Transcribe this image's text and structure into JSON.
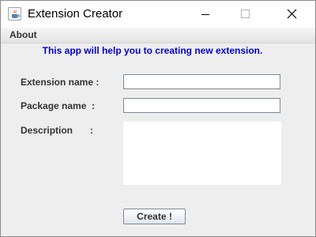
{
  "window": {
    "title": "Extension Creator",
    "icon": "java-cup-icon"
  },
  "title_buttons": {
    "minimize_icon": "minimize-icon",
    "maximize_icon": "maximize-icon",
    "close_icon": "close-icon"
  },
  "menubar": {
    "items": [
      {
        "label": "About"
      }
    ]
  },
  "form": {
    "subtitle": "This app will help you to creating new extension.",
    "extension_name": {
      "label": "Extension name :",
      "value": ""
    },
    "package_name": {
      "label": "Package name  :",
      "value": ""
    },
    "description": {
      "label": "Description",
      "colon": ":",
      "value": ""
    },
    "create_button": {
      "label": "Create !"
    }
  },
  "colors": {
    "subtitle": "#0000cc",
    "label": "#333333",
    "window_bg": "#eeeeee"
  }
}
